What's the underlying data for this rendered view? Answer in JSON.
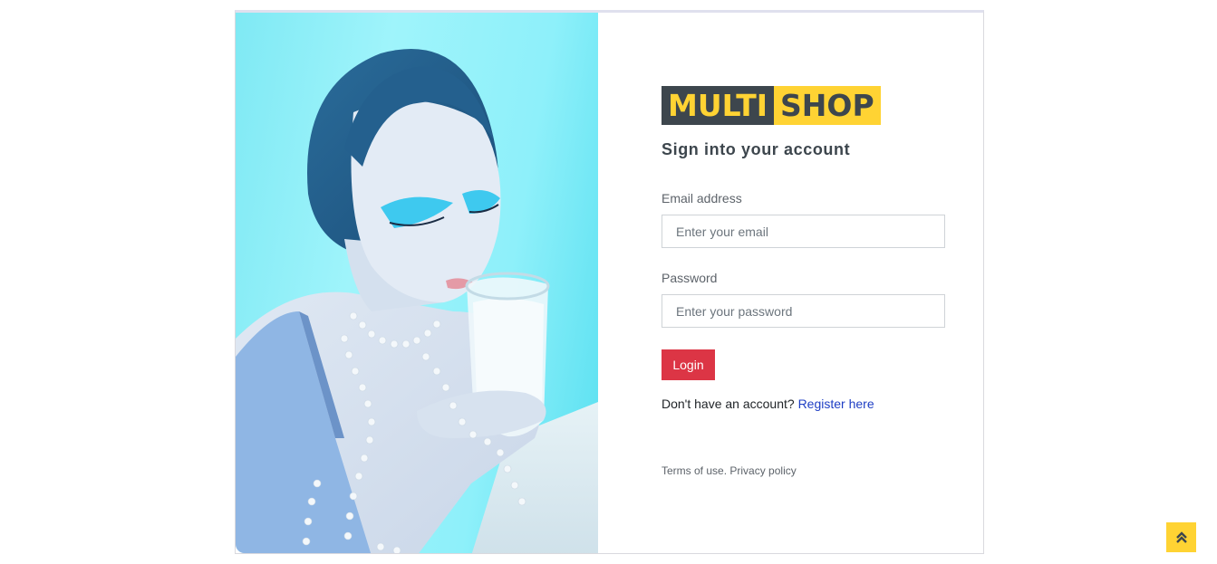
{
  "brand": {
    "part1": "MULTI",
    "part2": "SHOP"
  },
  "login": {
    "heading": "Sign into your account",
    "email_label": "Email address",
    "email_placeholder": "Enter your email",
    "password_label": "Password",
    "password_placeholder": "Enter your password",
    "submit_label": "Login",
    "register_prompt": "Don't have an account?",
    "register_link": "Register here",
    "terms_link": "Terms of use.",
    "privacy_link": "Privacy policy"
  },
  "colors": {
    "brand_dark": "#3d464d",
    "brand_yellow": "#ffd333",
    "login_button": "#dc3545",
    "link": "#1e3ec4"
  },
  "icons": {
    "back_to_top": "double-chevron-up-icon"
  }
}
